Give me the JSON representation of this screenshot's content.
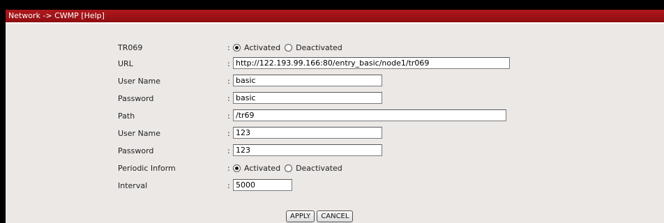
{
  "title": "Network -> CWMP [Help]",
  "colon": ":",
  "tr069": {
    "label": "TR069",
    "options": [
      "Activated",
      "Deactivated"
    ],
    "selected": "Activated"
  },
  "url": {
    "label": "URL",
    "value": "http://122.193.99.166:80/entry_basic/node1/tr069"
  },
  "acs_user": {
    "label": "User Name",
    "value": "basic"
  },
  "acs_password": {
    "label": "Password",
    "value": "basic"
  },
  "path": {
    "label": "Path",
    "value": "/tr69"
  },
  "cpe_user": {
    "label": "User Name",
    "value": "123"
  },
  "cpe_password": {
    "label": "Password",
    "value": "123"
  },
  "periodic": {
    "label": "Periodic Inform",
    "options": [
      "Activated",
      "Deactivated"
    ],
    "selected": "Activated"
  },
  "interval": {
    "label": "Interval",
    "value": "5000"
  },
  "buttons": {
    "apply": "APPLY",
    "cancel": "CANCEL"
  }
}
